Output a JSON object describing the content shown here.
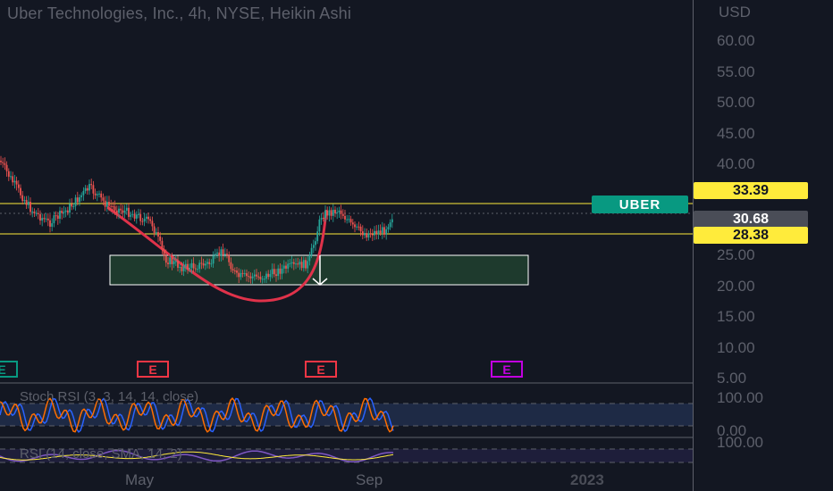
{
  "header": {
    "title": "Uber Technologies, Inc., 4h, NYSE, Heikin Ashi"
  },
  "price_axis": {
    "currency": "USD",
    "ticks": [
      "60.00",
      "55.00",
      "50.00",
      "45.00",
      "40.00",
      "25.00",
      "20.00",
      "15.00",
      "10.00",
      "5.00"
    ],
    "tags": {
      "upper": "33.39",
      "current": "30.68",
      "lower": "28.38"
    }
  },
  "symbol_label": "UBER",
  "earnings": {
    "marker": "E"
  },
  "indicators": {
    "stoch_label": "Stoch RSI (3, 3, 14, 14, close)",
    "stoch_top": "100.00",
    "stoch_bottom": "0.00",
    "rsi_label": "RSI (14, close, SMA, 14, 2)",
    "rsi_top": "100.00"
  },
  "time_axis": {
    "labels": [
      "May",
      "Sep",
      "2023"
    ]
  },
  "colors": {
    "up": "#26a69a",
    "down": "#ef5350",
    "level": "#ffeb3b",
    "zone_fill": "#1e3a2d",
    "arc": "#e0324a"
  }
}
